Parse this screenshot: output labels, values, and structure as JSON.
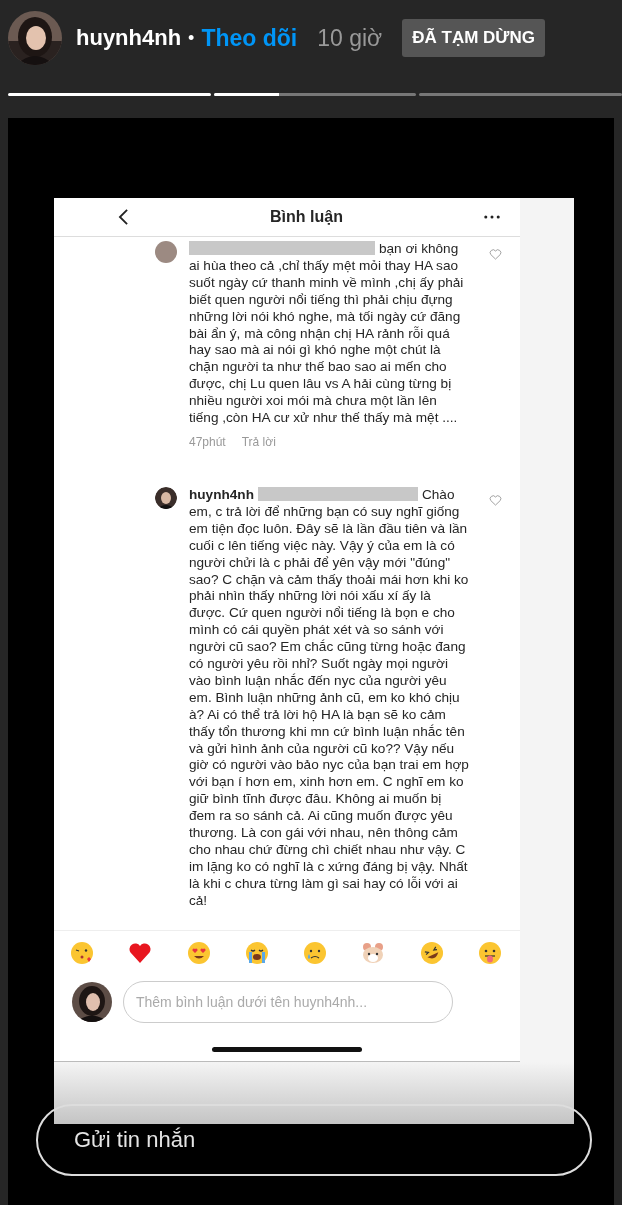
{
  "story_header": {
    "username": "huynh4nh",
    "separator": "•",
    "follow": "Theo dõi",
    "time": "10 giờ",
    "paused_badge": "ĐÃ TẠM DỪNG"
  },
  "progress": [
    {
      "kind": "filled",
      "level": 1
    },
    {
      "kind": "filled",
      "level": 0.32
    },
    {
      "kind": "empty"
    }
  ],
  "screenshot": {
    "title": "Bình luận",
    "comments": [
      {
        "redacted": true,
        "liked": false,
        "text": "bạn ơi không ai hùa theo cả ,chỉ thấy mệt mỏi thay HA sao suốt ngày cứ thanh minh về mình ,chị ấy phải biết quen người nổi tiếng thì phải chịu đựng những lời nói khó nghe, mà tối ngày cứ đăng bài ẩn ý, mà công nhận chị HA rảnh rỗi quá hay sao mà ai nói gì khó nghe một chút là chặn người ta như thế bao sao ai mến cho được, chị Lu quen lâu vs A hải cùng từng bị nhiều người xoi mói mà chưa một lần lên tiếng ,còn HA cư xử như thế thấy mà mệt ....",
        "time": "47phút",
        "reply": "Trả lời"
      },
      {
        "username": "huynh4nh",
        "redacted": true,
        "liked": false,
        "text": "Chào em, c trả lời để những bạn có suy nghĩ giống em tiện đọc luôn. Đây sẽ là lần đầu tiên và lần cuối c lên tiếng việc này. Vậy ý của em là có người chửi là c phải để yên vậy mới \"đúng\" sao? C chặn và cảm thấy thoải mái hơn khi ko phải nhìn thấy những lời nói xấu xí ấy là được. Cứ quen người nổi tiếng là bọn e cho mình có cái quyền phát xét và so sánh với người cũ sao? Em chắc cũng từng hoặc đang có người yêu rồi nhỉ? Suốt ngày mọi người vào bình luận nhắc đến nyc của người yêu em. Bình luận những ảnh cũ, em ko khó chịu à? Ai có thể trả lời hộ HA là bạn sẽ ko cảm thấy tổn thương khi mn cứ bình luận nhắc tên và gửi hình ảnh của người cũ ko?? Vậy nếu giờ có người vào bảo nyc của bạn trai em hợp với bạn í hơn em, xinh hơn em. C nghĩ em ko giữ bình tĩnh được đâu. Không ai muốn bị đem ra so sánh cả. Ai cũng muốn được yêu thương. Là con gái với nhau, nên thông cảm cho nhau chứ đừng chì chiết nhau như vậy. C im lặng ko có nghĩ là c xứng đáng bị vậy. Nhất là khi c chưa từng làm gì sai hay có lỗi với ai cả!"
      }
    ],
    "comment_field": {
      "placeholder": "Thêm bình luận dưới tên huynh4nh..."
    }
  },
  "message_field": {
    "placeholder": "Gửi tin nhắn"
  }
}
